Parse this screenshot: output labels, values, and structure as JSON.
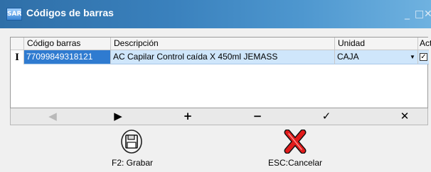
{
  "window": {
    "title": "Códigos de barras",
    "app_icon_text": "SAR"
  },
  "grid": {
    "columns": [
      "Código barras",
      "Descripción",
      "Unidad",
      "Activo"
    ],
    "rows": [
      {
        "codigo": "77099849318121",
        "descripcion": "AC Capilar Control caída X 450ml JEMASS",
        "unidad": "CAJA",
        "activo": true,
        "indicator": "I"
      }
    ]
  },
  "navigator": [
    "◀",
    "▶",
    "+",
    "−",
    "✓",
    "✕"
  ],
  "actions": {
    "save_label": "F2: Grabar",
    "cancel_label": "ESC:Cancelar"
  },
  "colors": {
    "titlebar": "#3a81bd",
    "selection": "#2f7bd0",
    "row_highlight": "#cfe6fb"
  }
}
